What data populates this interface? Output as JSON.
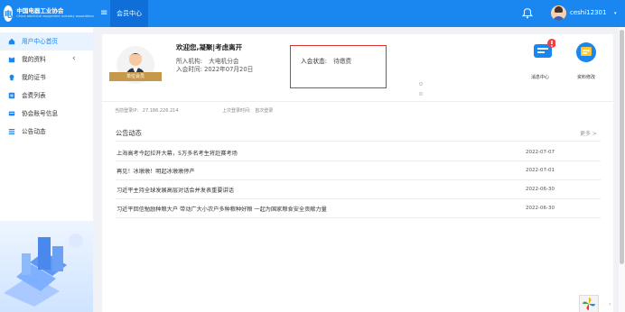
{
  "header": {
    "logo_cn": "中国电器工业协会",
    "logo_en": "China electrical equipment industry association",
    "logo_mark": "电",
    "tab": "会员中心",
    "username": "ceshi12301",
    "menu_icon": "hamburger-icon",
    "bell_icon": "bell-icon",
    "caret": "▾",
    "accent": "#1a86f0"
  },
  "sidebar": {
    "items": [
      {
        "label": "用户中心首页",
        "icon": "home-icon"
      },
      {
        "label": "我的资料",
        "icon": "profile-icon"
      },
      {
        "label": "我的证书",
        "icon": "certificate-icon"
      },
      {
        "label": "会费列表",
        "icon": "fee-list-icon"
      },
      {
        "label": "协会账号信息",
        "icon": "account-icon"
      },
      {
        "label": "公告动态",
        "icon": "announcement-icon"
      }
    ],
    "expand_arrow": "‹"
  },
  "profile": {
    "welcome": "欢迎您,凝聚|考虑离开",
    "org_label": "所入机构:",
    "org": "大电机分会",
    "join_time_label": "入会时间:",
    "join_time": "2022年07月20日",
    "status_label": "入会状态:",
    "status": "待缴费",
    "tag": "单位会员",
    "login_ip_label": "当前登录IP:",
    "login_ip": "27.186.226.214",
    "last_login_label": "上次登录时间:",
    "last_login": "首次登录",
    "msg_label": "消息中心",
    "edit_label": "资料修改"
  },
  "notices": {
    "title": "公告动态",
    "more": "更多 >",
    "items": [
      {
        "title": "上海高考今起拉开大幕，5万多名考生将赴赛考场",
        "date": "2022-07-07"
      },
      {
        "title": "再见！冰墩墩！明起冰墩墩停产",
        "date": "2022-07-01"
      },
      {
        "title": "习近平主持全球发展高层对话会并发表重要讲话",
        "date": "2022-06-30"
      },
      {
        "title": "习近平回信勉励种粮大户 带动广大小农户多种粮种好粮 一起为国家粮食安全贡献力量",
        "date": "2022-06-30"
      }
    ]
  },
  "bottom_arrow": "‹"
}
